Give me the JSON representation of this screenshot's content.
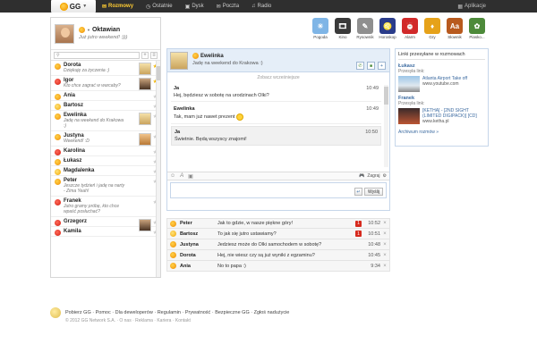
{
  "topbar": {
    "logo": "GG",
    "nav": [
      {
        "label": "Rozmowy",
        "icon": "chat-icon",
        "active": true
      },
      {
        "label": "Ostatnie",
        "icon": "clock-icon",
        "active": false
      },
      {
        "label": "Dysk",
        "icon": "disk-icon",
        "active": false
      },
      {
        "label": "Poczta",
        "icon": "mail-icon",
        "active": false
      },
      {
        "label": "Radio",
        "icon": "headphones-icon",
        "active": false
      }
    ],
    "apps_label": "Aplikacje"
  },
  "me": {
    "name": "Oktawian",
    "status": "Już jutro weekend! :)))"
  },
  "search": {
    "placeholder": ""
  },
  "contacts": [
    {
      "name": "Dorota",
      "desc": "Dziękuję za życzenia :)",
      "status": "available",
      "avatar": "girl",
      "star": true
    },
    {
      "name": "Igor",
      "desc": "Kto chce zagrać w warcaby?",
      "status": "busy",
      "avatar": "man",
      "star": true
    },
    {
      "name": "Ania",
      "desc": "",
      "status": "available",
      "avatar": "",
      "star": false
    },
    {
      "name": "Bartosz",
      "desc": "",
      "status": "glasses",
      "avatar": "",
      "star": false
    },
    {
      "name": "Ewelinka",
      "desc": "Jadę na weekend do Krakowa :)",
      "status": "available",
      "avatar": "girl",
      "star": false
    },
    {
      "name": "Justyna",
      "desc": "Weekend! :D",
      "status": "available",
      "avatar": "cat",
      "star": false
    },
    {
      "name": "Karolina",
      "desc": "",
      "status": "busy",
      "avatar": "",
      "star": false
    },
    {
      "name": "Łukasz",
      "desc": "",
      "status": "available",
      "avatar": "",
      "star": false
    },
    {
      "name": "Magdalenka",
      "desc": "",
      "status": "glasses",
      "avatar": "",
      "star": false
    },
    {
      "name": "Peter",
      "desc": "Jeszcze tydzień i jadę na narty - Zima Yeah!",
      "status": "available",
      "avatar": "",
      "star": false
    },
    {
      "name": "Franek",
      "desc": "Jutro gramy próbę, kto chce wpaść posłuchać?",
      "status": "busy",
      "avatar": "",
      "star": false
    },
    {
      "name": "Grzegorz",
      "desc": "",
      "status": "busy",
      "avatar": "man",
      "star": false
    },
    {
      "name": "Kamila",
      "desc": "",
      "status": "busy",
      "avatar": "",
      "star": false
    }
  ],
  "tiles": [
    {
      "label": "Pogoda",
      "icon": "weather-icon",
      "color": "#7fb5e6",
      "glyph": "☀"
    },
    {
      "label": "Kino",
      "icon": "film-icon",
      "color": "#3a3a3a",
      "glyph": "🎞"
    },
    {
      "label": "Rysownik",
      "icon": "pencil-icon",
      "color": "#8f8f8f",
      "glyph": "✎"
    },
    {
      "label": "Horoskop",
      "icon": "horoscope-icon",
      "color": "#2a3c8a",
      "glyph": "♌"
    },
    {
      "label": "Alarm",
      "icon": "alarm-icon",
      "color": "#d12a2a",
      "glyph": "⏰"
    },
    {
      "label": "Gry",
      "icon": "games-icon",
      "color": "#e6a21a",
      "glyph": "♦"
    },
    {
      "label": "Słownik",
      "icon": "dictionary-icon",
      "color": "#b85a1e",
      "glyph": "Aa"
    },
    {
      "label": "Piasko...",
      "icon": "sandbox-icon",
      "color": "#4d8a3a",
      "glyph": "✿"
    }
  ],
  "chat": {
    "name": "Ewelinka",
    "status": "Jadę na weekend do Krakowa :)",
    "history_link": "Zobacz wcześniejsze",
    "messages": [
      {
        "author": "Ja",
        "time": "10:49",
        "text": "Hej, będziesz w sobotę na urodzinach Olki?",
        "alt": false,
        "smiley": false
      },
      {
        "author": "Ewelinka",
        "time": "10:49",
        "text": "Tak, mam już nawet prezent",
        "alt": false,
        "smiley": true
      },
      {
        "author": "Ja",
        "time": "10:50",
        "text": "Świetnie. Będą wszyscy znajomi!",
        "alt": true,
        "smiley": false
      }
    ],
    "toolbar": {
      "invite": "Zagraj"
    },
    "send_label": "Wyślij"
  },
  "links_panel": {
    "title": "Linki przesyłane w rozmowach",
    "blocks": [
      {
        "name": "Łukasz",
        "sub": "Przesyła link:",
        "text": "Atlanta Airport Take off",
        "url": "www.youtube.com",
        "thumb": "plane"
      },
      {
        "name": "Franek",
        "sub": "Przesyła link:",
        "text": "[KETHA] - [2ND SIGHT (LIMITED DIGIPACK)] [CD]",
        "url": "www.ketha.pl",
        "thumb": "video"
      }
    ],
    "archive": "Archiwum rozmów »"
  },
  "conversations": [
    {
      "name": "Peter",
      "msg": "Jak to gdzie, w nasze piękne góry!",
      "badge": "1",
      "time": "10:52",
      "status": "available"
    },
    {
      "name": "Bartosz",
      "msg": "To jak się jutro ustawiamy?",
      "badge": "1",
      "time": "10:51",
      "status": "glasses"
    },
    {
      "name": "Justyna",
      "msg": "Jedziesz może do Olki samochodem w sobotę?",
      "badge": "",
      "time": "10:48",
      "status": "available"
    },
    {
      "name": "Dorota",
      "msg": "Hej, nie wiesz czy są już wyniki z egzaminu?",
      "badge": "",
      "time": "10:45",
      "status": "available"
    },
    {
      "name": "Ania",
      "msg": "No to papa :)",
      "badge": "",
      "time": "9:34",
      "status": "available"
    }
  ],
  "footer": {
    "links": "Pobierz GG · Pomoc · Dla deweloperów · Regulamin · Prywatność · Bezpieczne GG · Zgłoś nadużycie",
    "copyright": "© 2012 GG Network S.A. · O nas · Reklama · Kariera · Kontakt"
  }
}
